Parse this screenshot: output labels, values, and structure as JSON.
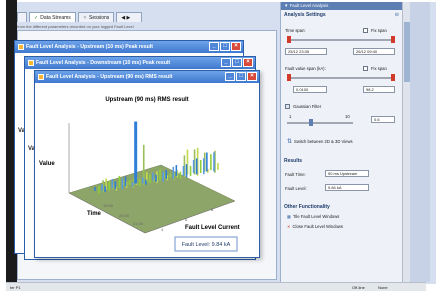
{
  "tabs": [
    {
      "label": "Data Streams",
      "icon": "data-streams-icon"
    },
    {
      "label": "Sessions",
      "icon": "sessions-icon"
    }
  ],
  "tab_nav": "◀ ▶",
  "subtext": "from the different parameters recorded on your logged Fault Level",
  "windows": {
    "back": {
      "title": "Fault Level Analysis - Upstream (10 ms) Peak result"
    },
    "mid": {
      "title": "Fault Level Analysis - Downstream (10 ms) Peak result"
    },
    "front": {
      "title": "Fault Level Analysis - Upstream (90 ms) RMS result"
    }
  },
  "side_labels": {
    "v1": "Va",
    "v2": "Va"
  },
  "chart_data": {
    "type": "area",
    "title": "Upstream (90 ms) RMS result",
    "zlabel": "Value",
    "xlabel": "Time",
    "ylabel": "Fault Level Current",
    "time_ticks": [
      "19:00",
      "20:00",
      "21:00"
    ],
    "fault_ticks": [
      "4",
      "6",
      "8"
    ],
    "peak_info": "Fault Level: 9.84 kA"
  },
  "right_panel": {
    "header": "▼ Fault Level Analysis",
    "section": "Analysis Settings",
    "time_span_label": "Time span:",
    "fix_span_label": "Fix span",
    "time_start": "25/12 23:35",
    "time_end": "26/12 09:40",
    "fault_value_label": "Fault value span (kA):",
    "fix_span2_label": "Fix span",
    "fault_min": "0.0100",
    "fault_max": "98.2",
    "gaussian_label": "Gaussian Filter",
    "gauss_min": "1",
    "gauss_max": "10",
    "gauss_value": "0.6",
    "switch_label": "Switch between 2D & 3D Views",
    "results_title": "Results",
    "fault_time_label": "Fault Time:",
    "fault_time_value": "90 ms Upstream",
    "fault_level_label": "Fault Level:",
    "fault_level_value": "9.84 kA",
    "other_title": "Other Functionality",
    "tile_label": "Tile Fault Level Windows",
    "close_label": "Close Fault Level Windows"
  },
  "statusbar": {
    "left": "ter P1",
    "right1": "Off-line",
    "right2": "None"
  }
}
